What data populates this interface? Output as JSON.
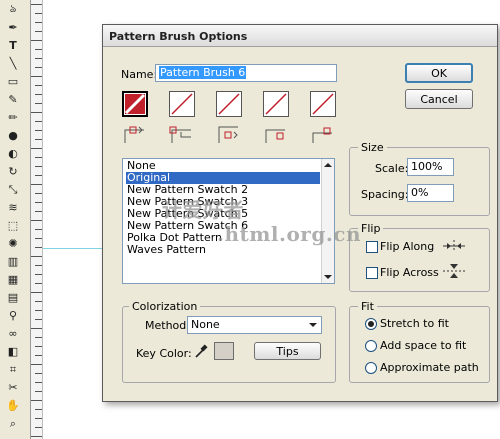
{
  "toolbar": {
    "tools": [
      "lasso-tool",
      "pen-tool",
      "type-tool",
      "line-tool",
      "rectangle-tool",
      "paintbrush-tool",
      "pencil-tool",
      "blob-brush-tool",
      "eraser-tool",
      "rotate-tool",
      "scale-tool",
      "warp-tool",
      "free-transform-tool",
      "symbol-sprayer-tool",
      "column-graph-tool",
      "mesh-tool",
      "gradient-tool",
      "eyedropper-tool",
      "blend-tool",
      "live-paint-tool",
      "live-paint-selection-tool",
      "slice-tool",
      "scissors-tool",
      "hand-tool",
      "zoom-tool"
    ]
  },
  "dialog": {
    "title": "Pattern Brush Options",
    "name_label": "Name:",
    "name_value": "Pattern Brush 6",
    "ok_label": "OK",
    "cancel_label": "Cancel",
    "tiles": [
      "side-tile",
      "outer-corner-tile",
      "inner-corner-tile",
      "start-tile",
      "end-tile"
    ],
    "swatch_list": {
      "items": [
        "None",
        "Original",
        "New Pattern Swatch 2",
        "New Pattern Swatch 3",
        "New Pattern Swatch 5",
        "New Pattern Swatch 6",
        "Polka Dot Pattern",
        "Waves Pattern"
      ],
      "selected": "Original"
    },
    "size": {
      "title": "Size",
      "scale_label": "Scale:",
      "scale_value": "100%",
      "spacing_label": "Spacing:",
      "spacing_value": "0%"
    },
    "flip": {
      "title": "Flip",
      "flip_along_label": "Flip Along",
      "flip_along_checked": false,
      "flip_across_label": "Flip Across",
      "flip_across_checked": false
    },
    "fit": {
      "title": "Fit",
      "options": [
        "Stretch to fit",
        "Add space to fit",
        "Approximate path"
      ],
      "selected": "Stretch to fit"
    },
    "colorization": {
      "title": "Colorization",
      "method_label": "Method:",
      "method_value": "None",
      "key_color_label": "Key Color:",
      "tips_label": "Tips"
    }
  },
  "watermark": {
    "line1": "计爱好者",
    "line2": ".html.org.cn"
  },
  "colors": {
    "tile_slash": "#c0202a",
    "selection": "#316ac5",
    "guide": "#7fd4e6"
  }
}
